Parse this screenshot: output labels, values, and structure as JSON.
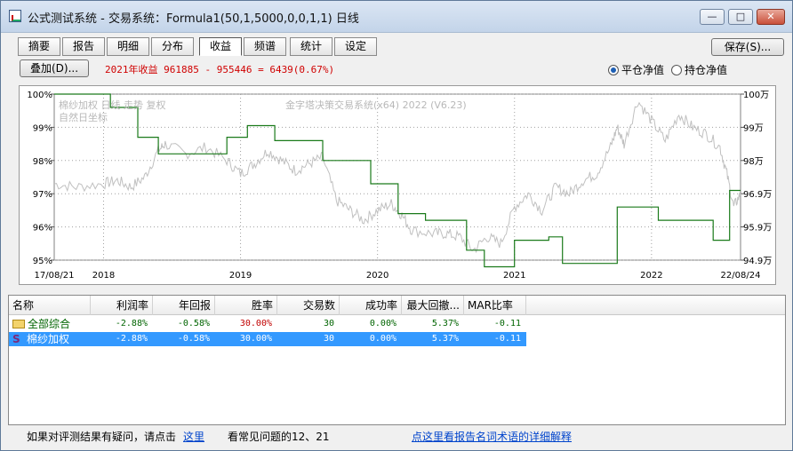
{
  "window": {
    "title": "公式测试系统 - 交易系统：Formula1(50,1,5000,0,0,1,1) 日线",
    "buttons": {
      "min": "—",
      "max": "□",
      "close": "✕"
    }
  },
  "tabs": [
    "摘要",
    "报告",
    "明细",
    "分布",
    "收益",
    "频谱",
    "统计",
    "设定"
  ],
  "active_tab": "收益",
  "save_button": "保存(S)...",
  "overlay_button": "叠加(D)...",
  "summary_text": "2021年收益 961885 - 955446 = 6439(0.67%)",
  "radios": {
    "selected": "平仓净值",
    "options": [
      "平仓净值",
      "持仓净值"
    ]
  },
  "chart_data": {
    "type": "line",
    "overlay_text_1": "棉纱加权 日线 走势 复权",
    "overlay_text_2": "自然日坐标",
    "watermark": "金字塔决策交易系统(x64) 2022 (V6.23)",
    "y_left_ticks": [
      "100%",
      "99%",
      "98%",
      "97%",
      "96%",
      "95%"
    ],
    "y_right_ticks": [
      "100万",
      "99万",
      "98万",
      "96.9万",
      "95.9万",
      "94.9万"
    ],
    "x_ticks": [
      "17/08/21",
      "2018",
      "2019",
      "2020",
      "2021",
      "2022",
      "22/08/24"
    ],
    "ylim_percent": [
      95,
      100
    ],
    "series": [
      {
        "color": "#1a7a1a",
        "step": true,
        "x": [
          2017.64,
          2018.05,
          2018.25,
          2018.4,
          2018.9,
          2019.05,
          2019.25,
          2019.6,
          2019.95,
          2020.15,
          2020.35,
          2020.65,
          2020.78,
          2021.0,
          2021.25,
          2021.35,
          2021.55,
          2021.75,
          2021.8,
          2022.05,
          2022.3,
          2022.45,
          2022.57,
          2022.65
        ],
        "y": [
          100.0,
          99.6,
          98.7,
          98.2,
          98.7,
          99.05,
          98.6,
          98.0,
          97.3,
          96.4,
          96.2,
          95.3,
          94.8,
          95.6,
          95.7,
          94.9,
          94.9,
          96.6,
          96.6,
          96.2,
          96.2,
          95.6,
          97.1,
          97.1
        ]
      },
      {
        "color": "#c0c0c0",
        "x": [
          2017.64,
          2017.8,
          2018.0,
          2018.1,
          2018.2,
          2018.3,
          2018.4,
          2018.45,
          2018.6,
          2018.75,
          2018.9,
          2019.0,
          2019.1,
          2019.2,
          2019.3,
          2019.4,
          2019.5,
          2019.6,
          2019.7,
          2019.8,
          2019.9,
          2020.0,
          2020.1,
          2020.17,
          2020.25,
          2020.4,
          2020.5,
          2020.6,
          2020.7,
          2020.8,
          2020.9,
          2021.0,
          2021.1,
          2021.2,
          2021.3,
          2021.4,
          2021.5,
          2021.6,
          2021.7,
          2021.75,
          2021.8,
          2021.9,
          2022.0,
          2022.1,
          2022.2,
          2022.3,
          2022.4,
          2022.5,
          2022.55,
          2022.6,
          2022.65
        ],
        "y": [
          97.3,
          97.2,
          97.3,
          97.4,
          97.2,
          97.5,
          98.3,
          98.5,
          98.2,
          98.4,
          98.0,
          97.6,
          97.9,
          98.3,
          98.0,
          97.7,
          97.9,
          98.1,
          96.8,
          96.5,
          96.2,
          96.5,
          96.7,
          96.4,
          95.9,
          95.8,
          95.8,
          95.7,
          95.3,
          95.7,
          95.5,
          96.6,
          97.0,
          96.5,
          97.2,
          97.0,
          97.4,
          97.6,
          98.4,
          99.0,
          98.5,
          99.8,
          99.2,
          98.6,
          99.4,
          99.0,
          98.8,
          98.4,
          97.6,
          96.6,
          97.0
        ]
      }
    ]
  },
  "table": {
    "headers": [
      "名称",
      "利润率",
      "年回报",
      "胜率",
      "交易数",
      "成功率",
      "最大回撤...",
      "MAR比率"
    ],
    "rows": [
      {
        "name": "全部综合",
        "profit": "-2.88%",
        "annual": "-0.58%",
        "win": "30.00%",
        "trades": "30",
        "success": "0.00%",
        "drawdown": "5.37%",
        "mar": "-0.11"
      },
      {
        "name": "棉纱加权",
        "profit": "-2.88%",
        "annual": "-0.58%",
        "win": "30.00%",
        "trades": "30",
        "success": "0.00%",
        "drawdown": "5.37%",
        "mar": "-0.11"
      }
    ]
  },
  "footer": {
    "question": "如果对评测结果有疑问，请点击",
    "here_link": "这里",
    "faq": "看常见问题的12、21",
    "glossary_link": "点这里看报告名词术语的详细解释"
  }
}
